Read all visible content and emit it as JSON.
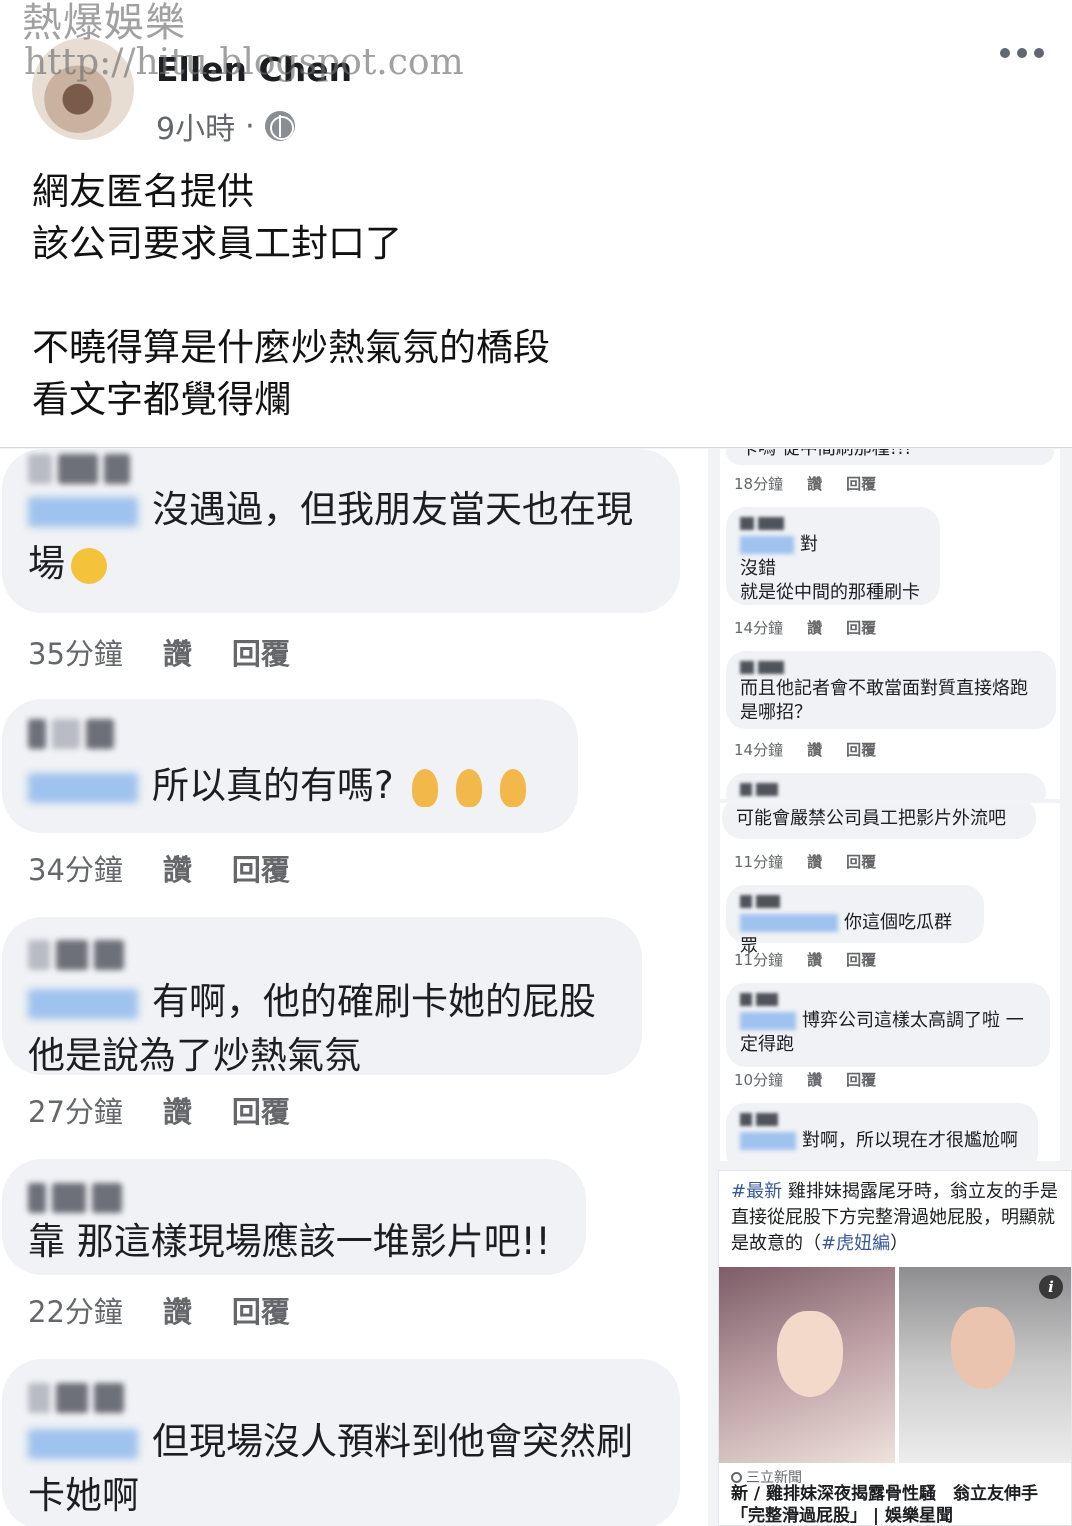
{
  "watermark": {
    "line1": "熱爆娛樂",
    "line2": "http://hitu.blogspot.com"
  },
  "post": {
    "author": "Ellen Chen",
    "time": "9小時",
    "separator": "·",
    "text_lines": [
      "網友匿名提供",
      "該公司要求員工封口了",
      "",
      "不曉得算是什麼炒熱氣氛的橋段",
      "看文字都覺得爛"
    ]
  },
  "actions": {
    "like": "讚",
    "reply": "回覆"
  },
  "left_comments": [
    {
      "text": "沒遇過，但我朋友當天也在現場",
      "line1": "沒遇過，但我朋友當天也在現",
      "line2": "場",
      "time": "35分鐘"
    },
    {
      "text": "所以真的有嗎?",
      "time": "34分鐘"
    },
    {
      "line1": "有啊，他的確刷卡她的屁股",
      "line2": "他是說為了炒熱氣氛",
      "time": "27分鐘"
    },
    {
      "text": "靠 那這樣現場應該一堆影片吧!!",
      "time": "22分鐘"
    },
    {
      "line1": "但現場沒人預料到他會突然刷",
      "line2": "卡她啊"
    }
  ],
  "right_top": {
    "cut_text": "卡嗎 從中間刷那種!!!",
    "comments": [
      {
        "time": "18分鐘"
      },
      {
        "lines": [
          "對",
          "沒錯",
          "就是從中間的那種刷卡"
        ],
        "time": "14分鐘"
      },
      {
        "lines": [
          "而且他記者會不敢當面對質直接烙跑",
          "是哪招？"
        ],
        "time": "14分鐘"
      }
    ]
  },
  "right_mid": {
    "comments": [
      {
        "lines": [
          "可能會嚴禁公司員工把影片外流吧"
        ],
        "time": "11分鐘"
      },
      {
        "lines": [
          "你這個吃瓜群眾"
        ],
        "time": "11分鐘"
      },
      {
        "lines": [
          "博弈公司這樣太高調了啦 一",
          "定得跑"
        ],
        "time": "10分鐘"
      },
      {
        "lines": [
          "對啊，所以現在才很尷尬啊"
        ]
      }
    ]
  },
  "news": {
    "hashtag1": "#最新",
    "body": " 雞排妹揭露尾牙時，翁立友的手是直接從屁股下方完整滑過她屁股，明顯就是故意的（",
    "hashtag2": "#虎妞編",
    "close": "）",
    "info": "i",
    "source": "三立新聞",
    "title": "新 / 雞排妹深夜揭露骨性騷　翁立友伸手「完整滑過屁股」 | 娛樂星聞"
  }
}
